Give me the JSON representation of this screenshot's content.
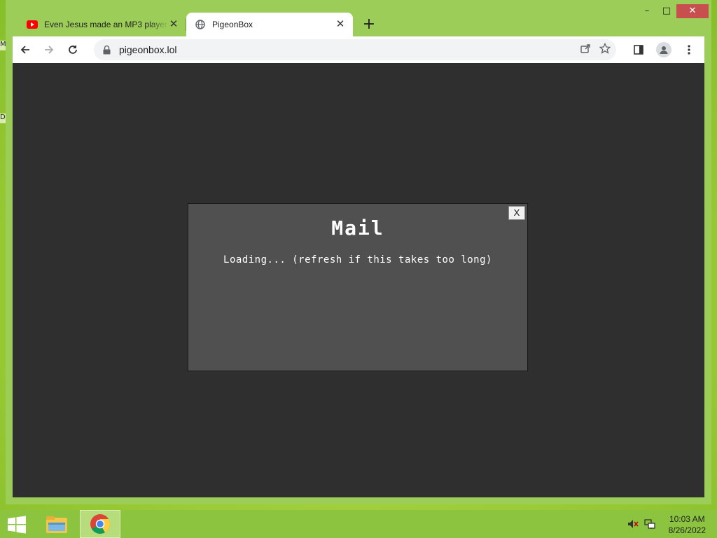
{
  "desktop": {
    "icon_labels": [
      "M",
      "D"
    ]
  },
  "browser": {
    "tabs": [
      {
        "title": "Even Jesus made an MP3 player",
        "favicon": "youtube-icon",
        "close": "✕",
        "active": false
      },
      {
        "title": "PigeonBox",
        "favicon": "globe-icon",
        "close": "✕",
        "active": true
      }
    ],
    "new_tab_label": "+",
    "window_controls": {
      "minimize": "–",
      "maximize": "□",
      "close": "✕"
    },
    "toolbar": {
      "url": "pigeonbox.lol"
    }
  },
  "page": {
    "modal": {
      "title": "Mail",
      "close_label": "X",
      "message": "Loading... (refresh if this takes too long)"
    }
  },
  "taskbar": {
    "apps": [
      "start-icon",
      "file-explorer-icon",
      "chrome-icon"
    ],
    "tray": [
      "volume-muted-icon",
      "network-icon"
    ],
    "time": "10:03 AM",
    "date": "8/26/2022"
  },
  "colors": {
    "page_bg": "#2f2f2f",
    "modal_bg": "#505050",
    "accent_green": "#9ccd58",
    "close_red": "#c7504f"
  }
}
